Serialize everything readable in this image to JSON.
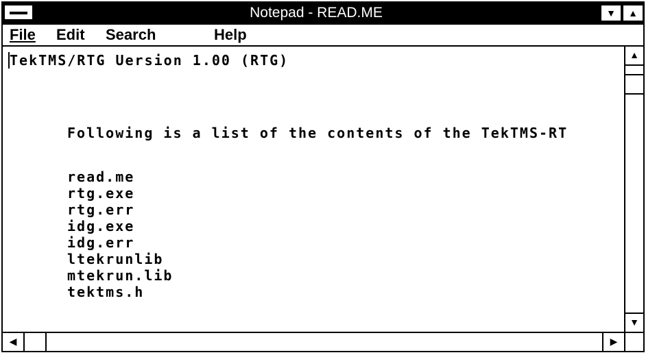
{
  "window": {
    "title": "Notepad - READ.ME"
  },
  "menu": {
    "file": "File",
    "edit": "Edit",
    "search": "Search",
    "help": "Help"
  },
  "document": {
    "lines": [
      "TekTMS/RTG Uersion 1.00 (RTG)",
      "Following is a list of the contents of the TekTMS-RT",
      "read.me",
      "rtg.exe",
      "rtg.err",
      "idg.exe",
      "idg.err",
      "ltekrunlib",
      "mtekrun.lib",
      "tektms.h"
    ]
  },
  "icons": {
    "system_menu": "system-menu-icon",
    "minimize": "minimize-icon",
    "maximize": "maximize-icon",
    "scroll_up": "arrow-up-icon",
    "scroll_down": "arrow-down-icon",
    "scroll_left": "arrow-left-icon",
    "scroll_right": "arrow-right-icon"
  },
  "colors": {
    "titlebar": "#000000",
    "background": "#ffffff"
  }
}
